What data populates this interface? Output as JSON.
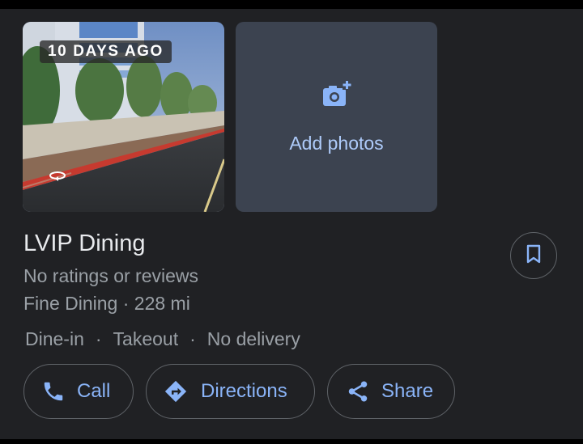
{
  "photo": {
    "age_badge": "10 DAYS AGO",
    "icon": "street-view-360-icon"
  },
  "add_photos": {
    "label": "Add photos",
    "icon": "add-photo-camera-icon"
  },
  "place": {
    "name": "LVIP Dining",
    "rating_text": "No ratings or reviews",
    "category": "Fine Dining",
    "separator": " · ",
    "distance": "228 mi",
    "services": [
      "Dine-in",
      "Takeout",
      "No delivery"
    ],
    "service_separator": "·"
  },
  "save_button": {
    "icon": "bookmark-icon"
  },
  "actions": {
    "call": {
      "label": "Call",
      "icon": "phone-icon"
    },
    "directions": {
      "label": "Directions",
      "icon": "directions-icon"
    },
    "share": {
      "label": "Share",
      "icon": "share-icon"
    }
  },
  "colors": {
    "background": "#202124",
    "accent": "#8ab4f8",
    "add_photos_bg": "#3c4350",
    "secondary_text": "#9aa0a6",
    "primary_text": "#e8eaed",
    "outline": "#5f6368"
  }
}
